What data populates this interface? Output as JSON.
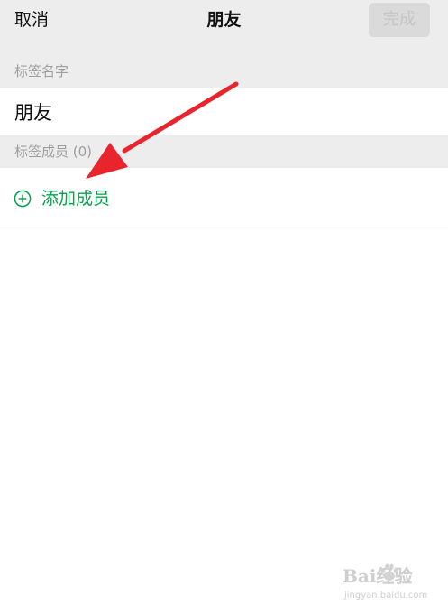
{
  "nav": {
    "cancel_label": "取消",
    "title": "朋友",
    "done_label": "完成"
  },
  "sections": {
    "tag_name_header": "标签名字",
    "tag_members_header": "标签成员 (0)"
  },
  "tag_name_field": {
    "value": "朋友"
  },
  "add_member": {
    "icon": "plus-circle-icon",
    "label": "添加成员"
  },
  "annotation": {
    "icon": "red-arrow-icon",
    "color": "#e8242c"
  },
  "watermark": {
    "brand": "Bai经验",
    "url": "jingyan.baidu.com"
  },
  "colors": {
    "accent_green": "#07a24f",
    "nav_background": "#ededed",
    "disabled_button_bg": "#dadada",
    "disabled_button_text": "#c5c5c5"
  }
}
